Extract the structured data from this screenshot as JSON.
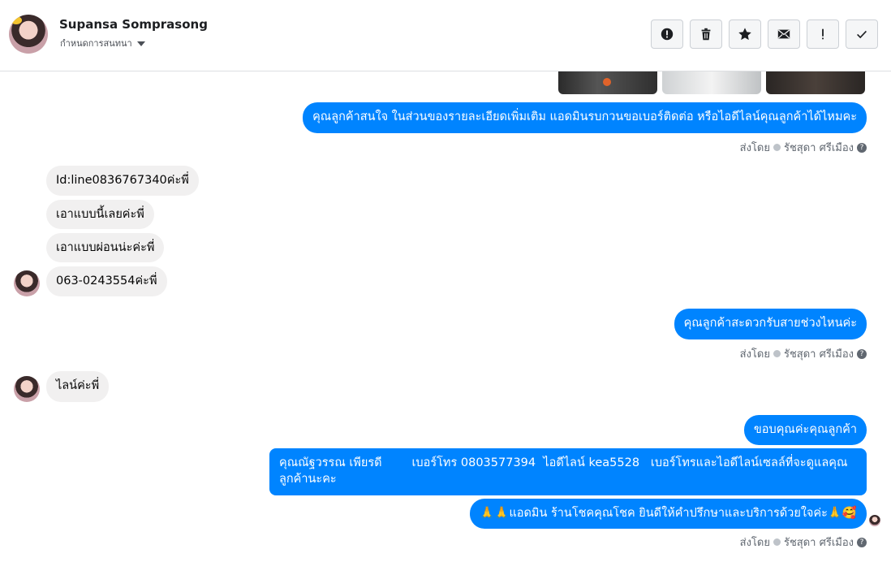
{
  "header": {
    "name": "Supansa Somprasong",
    "subtitle": "กำหนดการสนทนา",
    "buttons": [
      {
        "name": "alert-circle-icon"
      },
      {
        "name": "trash-icon"
      },
      {
        "name": "star-icon"
      },
      {
        "name": "mail-icon"
      },
      {
        "name": "exclamation-icon"
      },
      {
        "name": "check-icon"
      }
    ]
  },
  "messages": {
    "out1": "คุณลูกค้าสนใจ ในส่วนของรายละเอียดเพิ่มเติม แอดมินรบกวนขอเบอร์ติดต่อ หรือไอดีไลน์คุณลูกค้าได้ไหมคะ",
    "in1": "Id:line0836767340ค่ะพี่",
    "in2": "เอาแบบนี้เลยค่ะพี่",
    "in3": "เอาแบบผ่อนน่ะค่ะพี่",
    "in4": "063-0243554ค่ะพี่",
    "out2": "คุณลูกค้าสะดวกรับสายช่วงไหนค่ะ",
    "in5": "ไลน์ค่ะพี่",
    "out3": "ขอบคุณค่ะคุณลูกค้า",
    "out4_line1": "คุณณัฐวรรณ เพียรดี        เบอร์โทร 0803577394  ไอดีไลน์ kea5528   เบอร์โทรและไอดีไลน์เซลล์ที่จะดูแลคุณ",
    "out4_line2": "ลูกค้านะคะ",
    "out5": "🙏🙏แอดมิน ร้านโชคคุณโชค ยินดีให้คำปรึกษาและบริการด้วยใจค่ะ🙏🥰"
  },
  "sent_by": {
    "prefix": "ส่งโดย",
    "agent": "รัชสุดา ศรีเมือง",
    "help": "?"
  },
  "colors": {
    "outgoing": "#0084ff",
    "incoming": "#f1f0f0"
  }
}
